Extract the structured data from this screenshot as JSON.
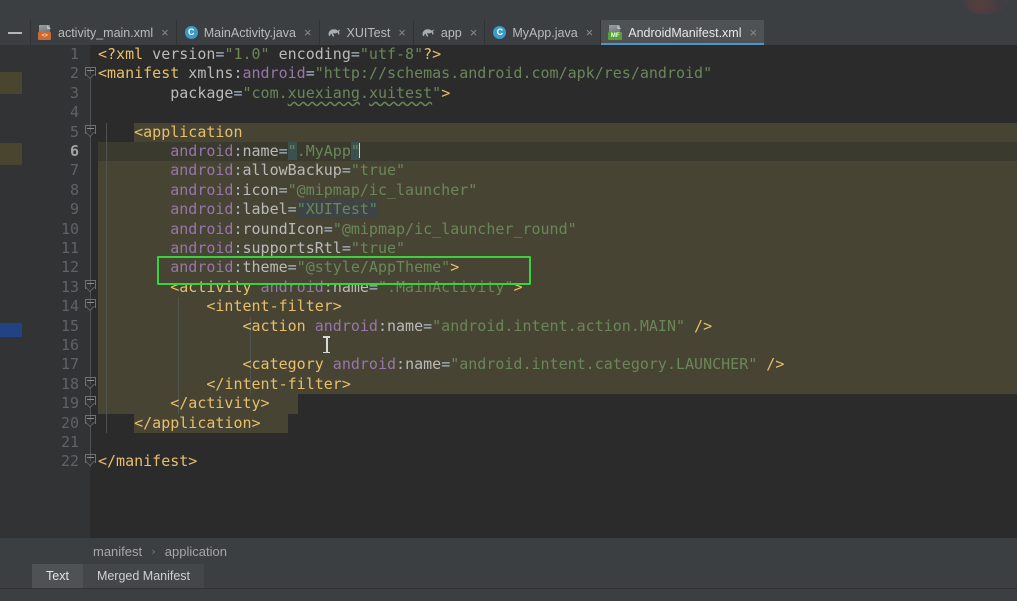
{
  "window": {
    "collapse_icon": "minimize-dash",
    "avatar_icon": "user-avatar-partial"
  },
  "tabs": [
    {
      "label": "activity_main.xml",
      "icon": "android-layout-xml-icon",
      "icon_badge": "<>",
      "active": false,
      "close": "×"
    },
    {
      "label": "MainActivity.java",
      "icon": "java-class-icon",
      "icon_badge": "C",
      "active": false,
      "close": "×"
    },
    {
      "label": "XUITest",
      "icon": "gradle-elephant-icon",
      "icon_badge": "",
      "active": false,
      "close": "×"
    },
    {
      "label": "app",
      "icon": "gradle-elephant-icon",
      "icon_badge": "",
      "active": false,
      "close": "×"
    },
    {
      "label": "MyApp.java",
      "icon": "java-class-icon",
      "icon_badge": "C",
      "active": false,
      "close": "×"
    },
    {
      "label": "AndroidManifest.xml",
      "icon": "android-manifest-icon",
      "icon_badge": "MF",
      "active": true,
      "close": "×"
    }
  ],
  "editor": {
    "active_line": 6,
    "line_numbers": [
      1,
      2,
      3,
      4,
      5,
      6,
      7,
      8,
      9,
      10,
      11,
      12,
      13,
      14,
      15,
      16,
      17,
      18,
      19,
      20,
      21,
      22
    ],
    "selected_text": "XUITest",
    "annotation": {
      "shape": "rectangle",
      "color": "#3ad23a",
      "target_line": 12
    },
    "lines": [
      {
        "n": 1,
        "text": "<?xml version=\"1.0\" encoding=\"utf-8\"?>"
      },
      {
        "n": 2,
        "text": "<manifest xmlns:android=\"http://schemas.android.com/apk/res/android\""
      },
      {
        "n": 3,
        "text": "    package=\"com.xuexiang.xuitest\">"
      },
      {
        "n": 4,
        "text": ""
      },
      {
        "n": 5,
        "text": "    <application"
      },
      {
        "n": 6,
        "text": "        android:name=\".MyApp\""
      },
      {
        "n": 7,
        "text": "        android:allowBackup=\"true\""
      },
      {
        "n": 8,
        "text": "        android:icon=\"@mipmap/ic_launcher\""
      },
      {
        "n": 9,
        "text": "        android:label=\"XUITest\""
      },
      {
        "n": 10,
        "text": "        android:roundIcon=\"@mipmap/ic_launcher_round\""
      },
      {
        "n": 11,
        "text": "        android:supportsRtl=\"true\""
      },
      {
        "n": 12,
        "text": "        android:theme=\"@style/AppTheme\">"
      },
      {
        "n": 13,
        "text": "        <activity android:name=\".MainActivity\">"
      },
      {
        "n": 14,
        "text": "            <intent-filter>"
      },
      {
        "n": 15,
        "text": "                <action android:name=\"android.intent.action.MAIN\" />"
      },
      {
        "n": 16,
        "text": ""
      },
      {
        "n": 17,
        "text": "                <category android:name=\"android.intent.category.LAUNCHER\" />"
      },
      {
        "n": 18,
        "text": "            </intent-filter>"
      },
      {
        "n": 19,
        "text": "        </activity>"
      },
      {
        "n": 20,
        "text": "    </application>"
      },
      {
        "n": 21,
        "text": ""
      },
      {
        "n": 22,
        "text": "</manifest>"
      }
    ]
  },
  "breadcrumb": {
    "items": [
      "manifest",
      "application"
    ],
    "separator": "›"
  },
  "bottom_tabs": [
    {
      "label": "Text",
      "active": true
    },
    {
      "label": "Merged Manifest",
      "active": false
    }
  ],
  "colors": {
    "editor_bg": "#2b2b2b",
    "gutter_bg": "#313335",
    "chrome_bg": "#3c3f41",
    "block_highlight": "#474434",
    "current_line": "#3b3a2e",
    "tag": "#e8bf6a",
    "attr_ns": "#9876aa",
    "attr_name": "#bababa",
    "string_value": "#6a8759",
    "punct": "#a9b7c6",
    "active_tab_underline": "#4a96c8",
    "annotation": "#3ad23a"
  }
}
